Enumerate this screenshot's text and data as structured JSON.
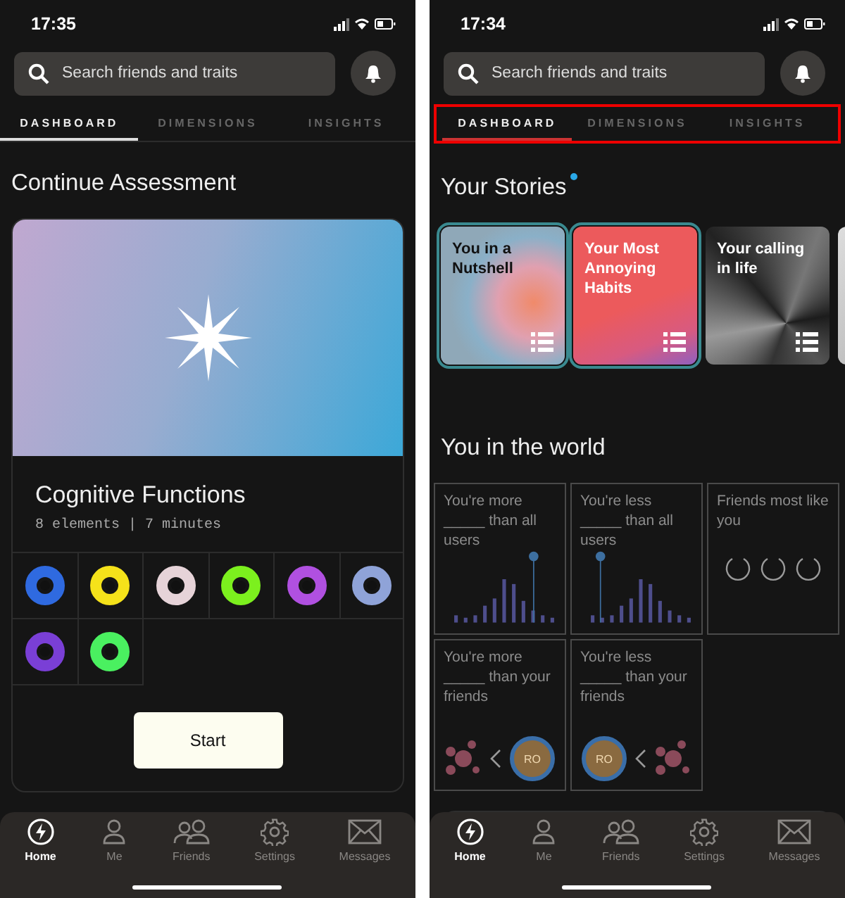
{
  "screens": [
    {
      "status_bar": {
        "time": "17:35"
      },
      "search": {
        "placeholder": "Search friends and traits"
      },
      "tabs_highlighted": false,
      "tabs": [
        {
          "label": "DASHBOARD",
          "selected": true
        },
        {
          "label": "DIMENSIONS",
          "selected": false
        },
        {
          "label": "INSIGHTS",
          "selected": false
        }
      ],
      "content": {
        "kind": "assessment",
        "heading": "Continue Assessment",
        "card": {
          "title": "Cognitive Functions",
          "subtitle": "8 elements | 7 minutes",
          "button": "Start",
          "elements": [
            {
              "color": "#2f6ae0"
            },
            {
              "color": "#f5e21a"
            },
            {
              "color": "#e6d3d8"
            },
            {
              "color": "#7cf01e"
            },
            {
              "color": "#b050e0"
            },
            {
              "color": "#8fa3d8"
            },
            {
              "color": "#7a3fd6"
            },
            {
              "color": "#4af060"
            }
          ]
        }
      },
      "nav": [
        {
          "label": "Home",
          "selected": true
        },
        {
          "label": "Me",
          "selected": false
        },
        {
          "label": "Friends",
          "selected": false
        },
        {
          "label": "Settings",
          "selected": false
        },
        {
          "label": "Messages",
          "selected": false
        }
      ]
    },
    {
      "status_bar": {
        "time": "17:34"
      },
      "search": {
        "placeholder": "Search friends and traits"
      },
      "tabs_highlighted": true,
      "tabs": [
        {
          "label": "DASHBOARD",
          "selected": true
        },
        {
          "label": "DIMENSIONS",
          "selected": false
        },
        {
          "label": "INSIGHTS",
          "selected": false
        }
      ],
      "content": {
        "kind": "stories",
        "stories_heading": "Your Stories",
        "stories_new": true,
        "stories": [
          {
            "title": "You in a Nutshell",
            "kind": "sphere",
            "outlined": true,
            "list_icon": true
          },
          {
            "title": "Your Most Annoying Habits",
            "kind": "coral",
            "outlined": true,
            "list_icon": true
          },
          {
            "title": "Your calling in life",
            "kind": "metal",
            "outlined": false,
            "list_icon": true
          },
          {
            "kind": "silver",
            "outlined": false
          }
        ],
        "world_heading": "You in the world",
        "tiles": [
          {
            "kind": "histogram_high",
            "text": "You're more _____ than all users"
          },
          {
            "kind": "histogram_low",
            "text": "You're less _____ than all users"
          },
          {
            "kind": "friends",
            "text": "Friends most like you"
          },
          {
            "kind": "friends_below",
            "text": "You're more _____ than your friends",
            "avatar": "RO"
          },
          {
            "kind": "friends_above",
            "text": "You're less _____ than your friends",
            "avatar": "RO"
          }
        ]
      },
      "nav": [
        {
          "label": "Home",
          "selected": true
        },
        {
          "label": "Me",
          "selected": false
        },
        {
          "label": "Friends",
          "selected": false
        },
        {
          "label": "Settings",
          "selected": false
        },
        {
          "label": "Messages",
          "selected": false
        }
      ]
    }
  ]
}
